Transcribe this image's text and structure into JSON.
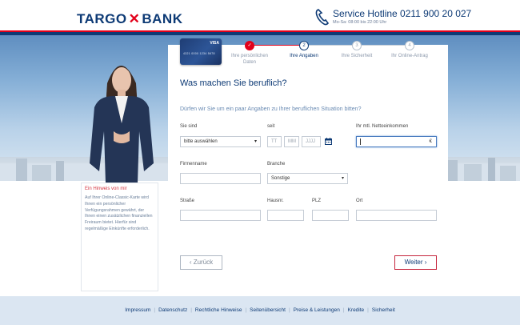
{
  "brand": {
    "logo_left": "TARGO",
    "logo_mark": "✕",
    "logo_right": "BANK",
    "primary_color": "#0d3a75",
    "accent_color": "#e2001a"
  },
  "header": {
    "hotline": "Service Hotline 0211 900 20 027",
    "hours": "Mo-Sa: 08:00 bis 22:00 Uhr",
    "phone_icon": "phone-icon"
  },
  "card": {
    "brand": "VISA",
    "number": "4321 0000 1234 5678"
  },
  "steps": [
    {
      "number": "✓",
      "label_line1": "Ihre persönlichen",
      "label_line2": "Daten",
      "state": "done"
    },
    {
      "number": "2",
      "label_line1": "Ihre Angaben",
      "label_line2": "",
      "state": "active"
    },
    {
      "number": "3",
      "label_line1": "Ihre Sicherheit",
      "label_line2": "",
      "state": "todo"
    },
    {
      "number": "4",
      "label_line1": "Ihr Online-Antrag",
      "label_line2": "",
      "state": "todo"
    }
  ],
  "form": {
    "title": "Was machen Sie beruflich?",
    "subtitle": "Dürfen wir Sie um ein paar Angaben zu Ihrer beruflichen Situation bitten?",
    "labels": {
      "sie_sind": "Sie sind",
      "seit": "seit",
      "einkommen": "Ihr mtl. Nettoeinkommen",
      "firmenname": "Firmenname",
      "branche": "Branche",
      "strasse": "Straße",
      "hausnr": "Hausnr.",
      "plz": "PLZ",
      "ort": "Ort"
    },
    "values": {
      "sie_sind": "bitte auswählen",
      "seit_tt": "TT",
      "seit_mm": "MM",
      "seit_jjjj": "JJJJ",
      "einkommen": "",
      "currency": "€",
      "firmenname": "",
      "branche": "Sonstige",
      "strasse": "",
      "hausnr": "",
      "plz": "",
      "ort": ""
    },
    "back_label": "‹  Zurück",
    "next_label": "Weiter  ›"
  },
  "hint": {
    "title": "Ein Hinweis von mir",
    "text": "Auf Ihrer Online-Classic-Karte wird Ihnen ein persönlicher Verfügungsrahmen gewährt, der Ihnen einen zusätzlichen finanziellen Freiraum bietet. Hierfür sind regelmäßige Einkünfte erforderlich."
  },
  "footer": {
    "links": [
      "Impressum",
      "Datenschutz",
      "Rechtliche Hinweise",
      "Seitenübersicht",
      "Preise & Leistungen",
      "Kredite",
      "Sicherheit"
    ]
  }
}
